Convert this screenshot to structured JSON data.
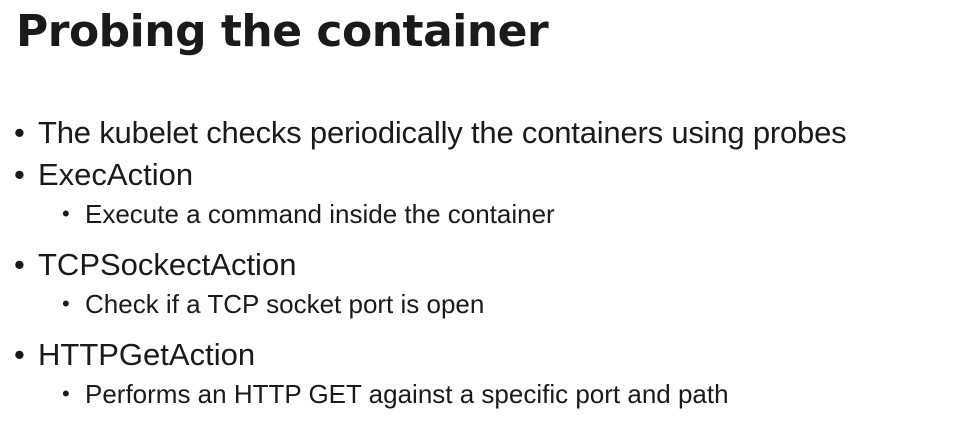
{
  "slide": {
    "title": "Probing the container",
    "items": [
      {
        "text": "The kubelet checks periodically the containers using probes",
        "sub": []
      },
      {
        "text": "ExecAction",
        "sub": [
          "Execute a command inside the container"
        ]
      },
      {
        "text": "TCPSockectAction",
        "sub": [
          "Check if a TCP socket port is open"
        ]
      },
      {
        "text": "HTTPGetAction",
        "sub": [
          "Performs an HTTP GET against a specific port and path"
        ]
      }
    ],
    "bullet_glyph": "•"
  }
}
